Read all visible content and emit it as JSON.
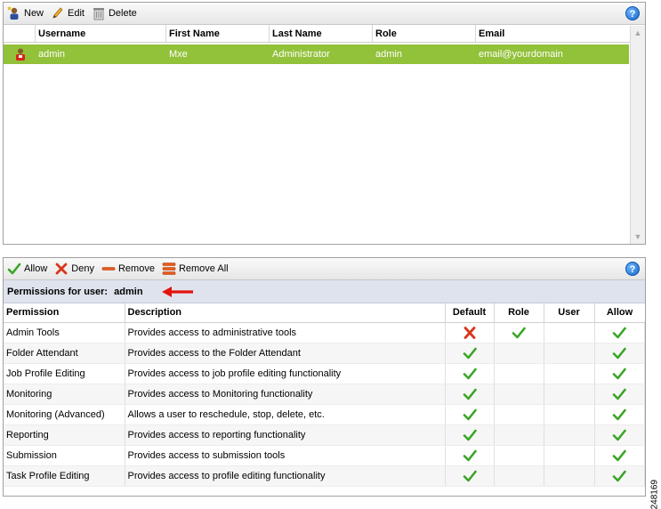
{
  "users_toolbar": {
    "new_label": "New",
    "edit_label": "Edit",
    "delete_label": "Delete",
    "help_label": "?"
  },
  "users_grid": {
    "columns": [
      "Username",
      "First Name",
      "Last Name",
      "Role",
      "Email"
    ],
    "rows": [
      {
        "username": "admin",
        "first_name": "Mxe",
        "last_name": "Administrator",
        "role": "admin",
        "email": "email@yourdomain"
      }
    ]
  },
  "perm_toolbar": {
    "allow_label": "Allow",
    "deny_label": "Deny",
    "remove_label": "Remove",
    "remove_all_label": "Remove All",
    "help_label": "?"
  },
  "perm_header": {
    "label": "Permissions for user:",
    "user": "admin"
  },
  "perm_grid": {
    "columns": [
      "Permission",
      "Description",
      "Default",
      "Role",
      "User",
      "Allow"
    ],
    "rows": [
      {
        "permission": "Admin Tools",
        "description": "Provides access to administrative tools",
        "default": "deny",
        "role": "allow",
        "user": "",
        "allow": "allow"
      },
      {
        "permission": "Folder Attendant",
        "description": "Provides access to the Folder Attendant",
        "default": "allow",
        "role": "",
        "user": "",
        "allow": "allow"
      },
      {
        "permission": "Job Profile Editing",
        "description": "Provides access to job profile editing functionality",
        "default": "allow",
        "role": "",
        "user": "",
        "allow": "allow"
      },
      {
        "permission": "Monitoring",
        "description": "Provides access to Monitoring functionality",
        "default": "allow",
        "role": "",
        "user": "",
        "allow": "allow"
      },
      {
        "permission": "Monitoring (Advanced)",
        "description": "Allows a user to reschedule, stop, delete, etc.",
        "default": "allow",
        "role": "",
        "user": "",
        "allow": "allow"
      },
      {
        "permission": "Reporting",
        "description": "Provides access to reporting functionality",
        "default": "allow",
        "role": "",
        "user": "",
        "allow": "allow"
      },
      {
        "permission": "Submission",
        "description": "Provides access to submission tools",
        "default": "allow",
        "role": "",
        "user": "",
        "allow": "allow"
      },
      {
        "permission": "Task Profile Editing",
        "description": "Provides access to profile editing functionality",
        "default": "allow",
        "role": "",
        "user": "",
        "allow": "allow"
      }
    ]
  },
  "figure_id": "248169",
  "colors": {
    "selected_row": "#92c13a",
    "allow_check": "#3aa526",
    "deny_x": "#d9351b",
    "remove_bar": "#e85a1c",
    "arrow": "#e3150f"
  }
}
